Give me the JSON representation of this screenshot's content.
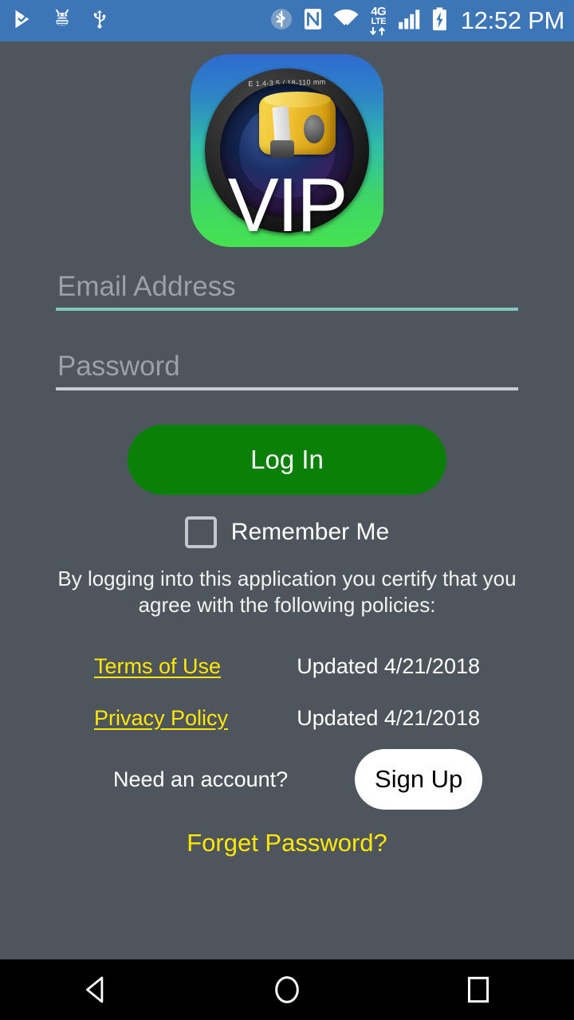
{
  "statusbar": {
    "background_color": "#3d76b6",
    "clock": "12:52 PM",
    "left_icons": [
      {
        "name": "play-check-icon",
        "label": "Play Protect"
      },
      {
        "name": "debug-bug-icon",
        "label": "USB debugging"
      },
      {
        "name": "usb-icon",
        "label": "USB connected"
      }
    ],
    "right_icons": [
      {
        "name": "bluetooth-icon",
        "label": "Bluetooth"
      },
      {
        "name": "nfc-icon",
        "label": "NFC"
      },
      {
        "name": "wifi-icon",
        "label": "Wi-Fi"
      },
      {
        "name": "network-type-icon",
        "line1": "4G",
        "line2": "LTE"
      },
      {
        "name": "signal-bars-icon",
        "label": "Cellular signal"
      },
      {
        "name": "battery-charging-icon",
        "label": "Battery charging"
      }
    ]
  },
  "app": {
    "background_color": "#4e555c",
    "logo": {
      "name": "vip-app-logo",
      "wordmark": "VIP",
      "lens_ring_text": "E 1.4-3.5 / 18-110 mm"
    }
  },
  "form": {
    "email": {
      "placeholder": "Email Address",
      "value": "",
      "underline_color": "#7fc6bc"
    },
    "password": {
      "placeholder": "Password",
      "value": "",
      "underline_color": "#c7cdd4"
    },
    "login_button": {
      "label": "Log In",
      "color": "#0a8008",
      "text_color": "#ffffff"
    },
    "remember_me": {
      "label": "Remember Me",
      "checked": false
    }
  },
  "policies": {
    "notice": "By logging into this application you certify that you agree with the following policies:",
    "link_color": "#ffe800",
    "rows": [
      {
        "link": "Terms of Use",
        "updated": "Updated 4/21/2018"
      },
      {
        "link": "Privacy Policy",
        "updated": "Updated 4/21/2018"
      }
    ]
  },
  "signup": {
    "prompt": "Need an account?",
    "button_label": "Sign Up",
    "button_color": "#ffffff",
    "button_text_color": "#000000"
  },
  "forget_password": {
    "label": "Forget Password?",
    "color": "#ffe800"
  },
  "navbar": {
    "background_color": "#000000",
    "buttons": [
      {
        "name": "nav-back-button",
        "label": "Back"
      },
      {
        "name": "nav-home-button",
        "label": "Home"
      },
      {
        "name": "nav-recents-button",
        "label": "Recent apps"
      }
    ]
  }
}
